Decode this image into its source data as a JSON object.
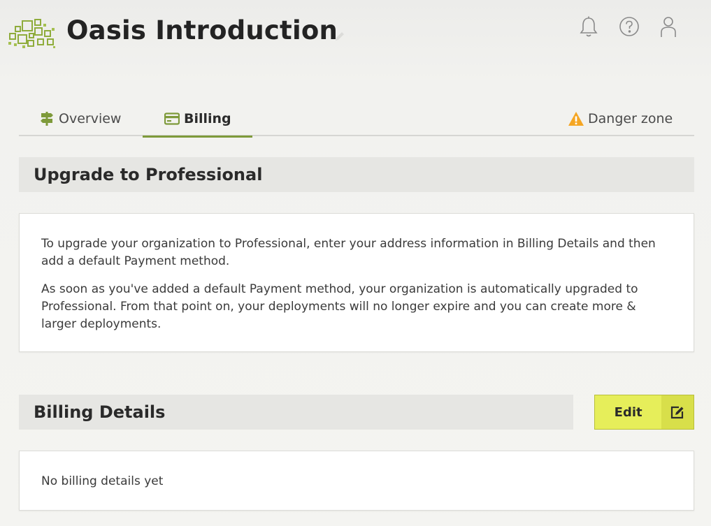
{
  "header": {
    "title": "Oasis Introduction",
    "icons": [
      "bell-icon",
      "help-icon",
      "user-icon"
    ]
  },
  "tabs": [
    {
      "label": "Overview",
      "icon": "signpost-icon",
      "active": false
    },
    {
      "label": "Billing",
      "icon": "credit-card-icon",
      "active": true
    },
    {
      "label": "Danger zone",
      "icon": "warning-icon",
      "active": false
    }
  ],
  "upgrade": {
    "title": "Upgrade to Professional",
    "paragraph1": "To upgrade your organization to Professional, enter your address information in Billing Details and then add a default Payment method.",
    "paragraph2": "As soon as you've added a default Payment method, your organization is automatically upgraded to Professional. From that point on, your deployments will no longer expire and you can create more & larger deployments."
  },
  "billing": {
    "title": "Billing Details",
    "edit_label": "Edit",
    "empty_text": "No billing details yet"
  },
  "colors": {
    "accent": "#7e9a3a",
    "edit_button": "#e6ee5a",
    "warning": "#f5a623"
  }
}
